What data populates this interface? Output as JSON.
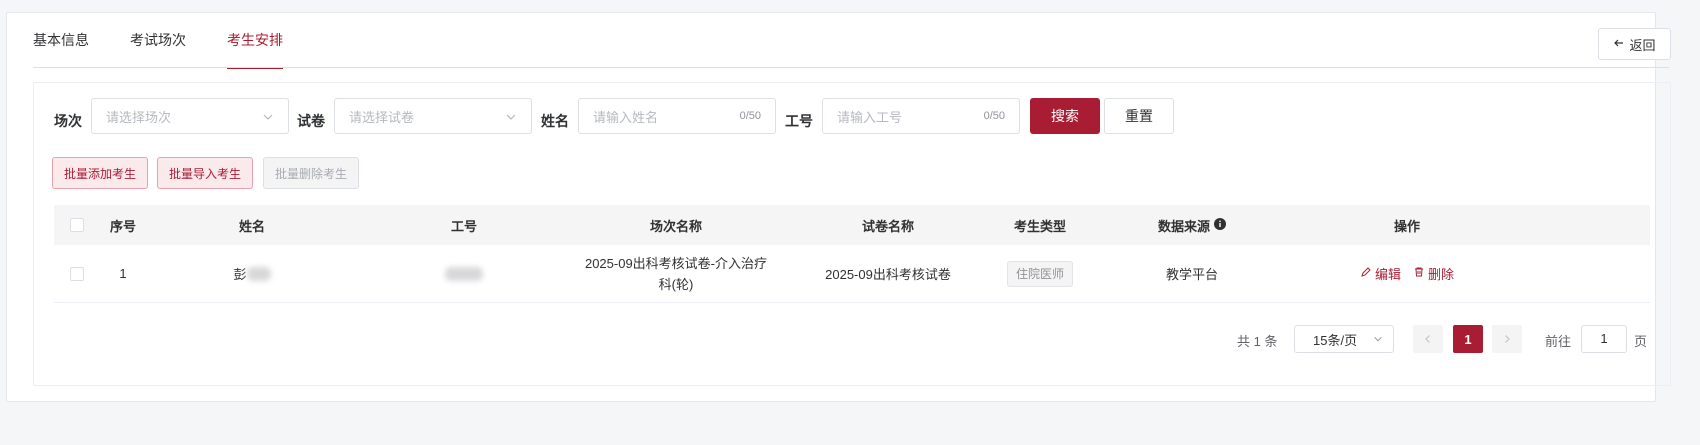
{
  "tabs": [
    "基本信息",
    "考试场次",
    "考生安排"
  ],
  "back_label": "返回",
  "filters": {
    "session": {
      "label": "场次",
      "placeholder": "请选择场次"
    },
    "paper": {
      "label": "试卷",
      "placeholder": "请选择试卷"
    },
    "name": {
      "label": "姓名",
      "placeholder": "请输入姓名",
      "count": "0/50"
    },
    "empno": {
      "label": "工号",
      "placeholder": "请输入工号",
      "count": "0/50"
    },
    "search": "搜索",
    "reset": "重置"
  },
  "batch": {
    "add": "批量添加考生",
    "import": "批量导入考生",
    "delete": "批量删除考生"
  },
  "table": {
    "headers": [
      "序号",
      "姓名",
      "工号",
      "场次名称",
      "试卷名称",
      "考生类型",
      "数据来源",
      "操作"
    ],
    "rows": [
      {
        "index": "1",
        "name_visible": "彭",
        "session_line1": "2025-09出科考核试卷-介入治疗",
        "session_line2": "科(轮)",
        "paper": "2025-09出科考核试卷",
        "type": "住院医师",
        "source": "教学平台",
        "edit": "编辑",
        "delete": "删除"
      }
    ]
  },
  "pagination": {
    "total": "共 1 条",
    "page_size": "15条/页",
    "current": "1",
    "goto_prefix": "前往",
    "goto_value": "1",
    "goto_suffix": "页"
  },
  "colors": {
    "accent": "#a91d34"
  }
}
